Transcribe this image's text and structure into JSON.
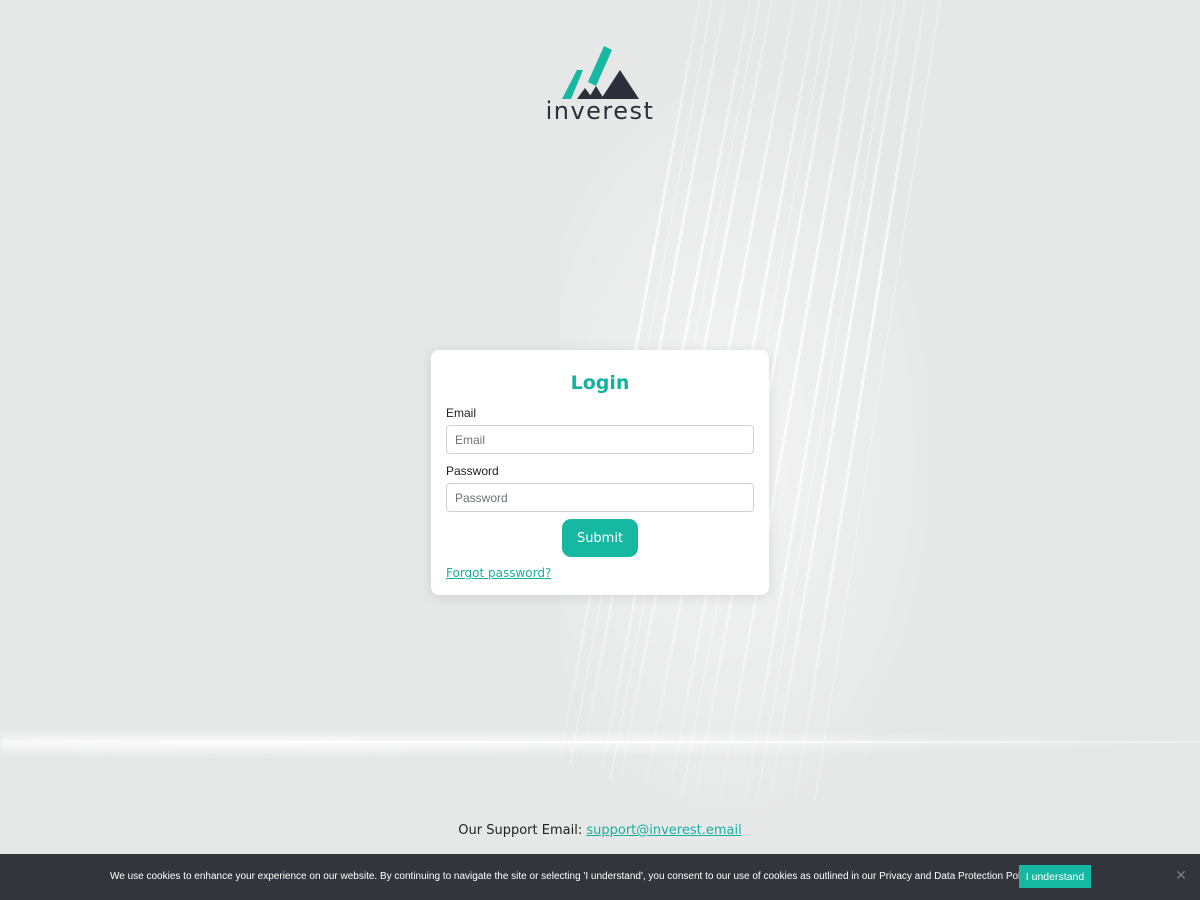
{
  "brand": {
    "name": "inverest",
    "colors": {
      "accent": "#17b8a2",
      "dark": "#2a2f3a",
      "background": "#e6e7e7",
      "cookie_bar": "#32353c"
    }
  },
  "login": {
    "title": "Login",
    "email_label": "Email",
    "email_placeholder": "Email",
    "email_value": "",
    "password_label": "Password",
    "password_placeholder": "Password",
    "password_value": "",
    "submit_label": "Submit",
    "forgot_label": "Forgot password?"
  },
  "support": {
    "label": "Our Support Email: ",
    "email": "support@inverest.email"
  },
  "cookie": {
    "text": "We use cookies to enhance your experience on our website. By continuing to navigate the site or selecting 'I understand', you consent to our use of cookies as outlined in our Privacy and Data Protection Policy.",
    "button_label": "I understand",
    "close_icon": "close-icon"
  }
}
